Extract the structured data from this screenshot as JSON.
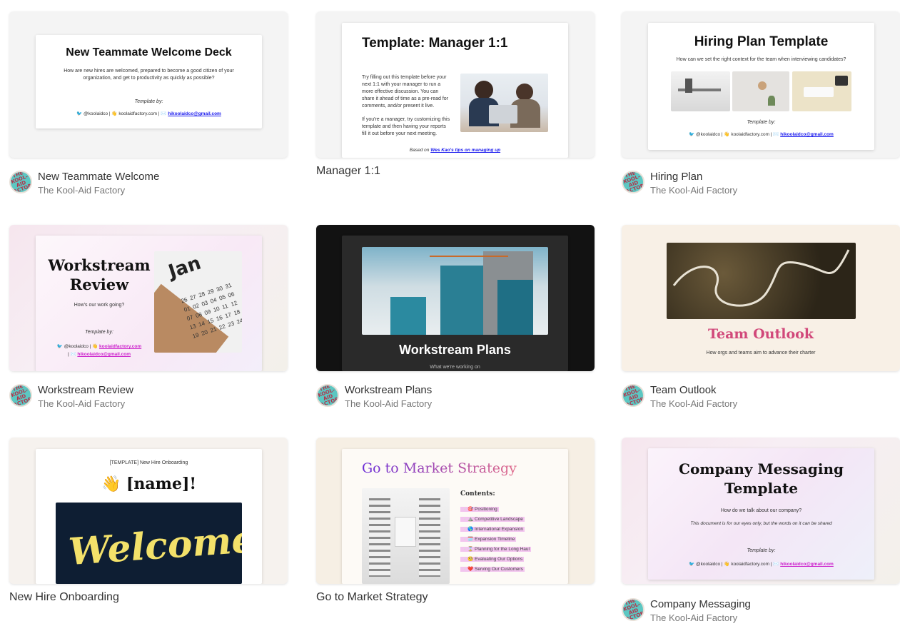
{
  "cards": [
    {
      "title": "New Teammate Welcome",
      "author": "The Kool-Aid Factory",
      "slide": {
        "heading": "New Teammate Welcome Deck",
        "body": "How are new hires are welcomed, prepared to become a good citizen of your organization, and get to productivity as quickly as possible?",
        "template_by": "Template by:",
        "credits_prefix": "🐦 @koolaidco | 👋 koolaidfactory.com | ✉️ ",
        "email": "hikoolaidco@gmail.com"
      }
    },
    {
      "title": "Manager 1:1",
      "slide": {
        "heading": "Template: Manager 1:1",
        "para1": "Try filling out this template before your next 1:1 with your manager to run a more effective discussion. You can share it ahead of time as a pre-read for comments, and/or present it live.",
        "para2": "If you're a manager, try customizing this template and then having your reports fill it out before your next meeting.",
        "based_on": "Based on ",
        "based_link": "Wes Kao's tips on managing up"
      }
    },
    {
      "title": "Hiring Plan",
      "author": "The Kool-Aid Factory",
      "slide": {
        "heading": "Hiring Plan Template",
        "body": "How can we set the right context for the team when interviewing candidates?",
        "template_by": "Template by:",
        "credits_prefix": "🐦 @koolaidco | 👋 koolaidfactory.com | ✉️ ",
        "email": "hikoolaidco@gmail.com"
      }
    },
    {
      "title": "Workstream Review",
      "author": "The Kool-Aid Factory",
      "slide": {
        "heading": "Workstream Review",
        "body": "How's our work going?",
        "template_by": "Template by:",
        "credits_prefix": "🐦 @koolaidco | 👋 ",
        "site": "koolaidfactory.com",
        "credits_mid": "| ✉️ ",
        "email": "hikoolaidco@gmail.com",
        "calendar_month": "Jan",
        "calendar_days": [
          "26",
          "27",
          "28",
          "29",
          "30",
          "31",
          "01",
          "02",
          "03",
          "04",
          "05",
          "06",
          "07",
          "08",
          "09",
          "10",
          "11",
          "12",
          "13",
          "14",
          "15",
          "16",
          "17",
          "18",
          "19",
          "20",
          "21",
          "22",
          "23",
          "24"
        ]
      }
    },
    {
      "title": "Workstream Plans",
      "author": "The Kool-Aid Factory",
      "slide": {
        "heading": "Workstream Plans",
        "sub": "What we're working on"
      }
    },
    {
      "title": "Team Outlook",
      "author": "The Kool-Aid Factory",
      "slide": {
        "heading": "Team Outlook",
        "body": "How orgs and teams aim to advance their charter"
      }
    },
    {
      "title": "New Hire Onboarding",
      "slide": {
        "label": "[TEMPLATE] New Hire Onboarding",
        "greeting": "👋 [name]!",
        "banner": "Welcome"
      }
    },
    {
      "title": "Go to Market Strategy",
      "slide": {
        "heading": "Go to Market Strategy",
        "contents_label": "Contents:",
        "contents": [
          "▫️🎯 Positioning",
          "▫️⛰️ Competitive Landscape",
          "▫️🌎 International Expansion",
          "▫️🗓️ Expansion Timeline",
          "▫️⌛ Planning for the Long Haul",
          "▫️🧐 Evaluating Our Options",
          "▫️❤️ Serving Our Customers"
        ]
      }
    },
    {
      "title": "Company Messaging",
      "author": "The Kool-Aid Factory",
      "slide": {
        "heading": "Company Messaging Template",
        "body": "How do we talk about our company?",
        "note": "This document is for our eyes only, but the words on it can be shared",
        "template_by": "Template by:",
        "credits_prefix": "🐦 @koolaidco | 👋 koolaidfactory.com | ✉️ ",
        "email": "hikoolaidco@gmail.com"
      }
    }
  ],
  "avatar_text": "THE KOOL-AID FACTORY",
  "colors": {
    "team_outlook": "#d1487a",
    "gtm_gradient_start": "#6a2bd6",
    "gtm_gradient_end": "#e06a8a",
    "avatar_bg": "#5cc7c2"
  }
}
